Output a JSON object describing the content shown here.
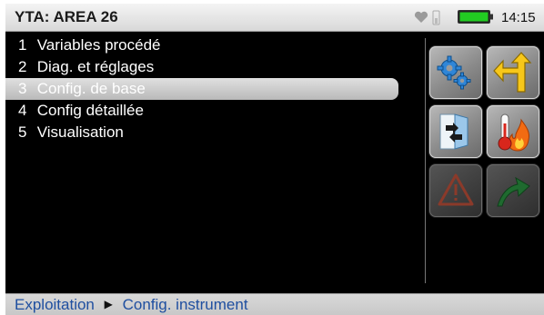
{
  "status_bar": {
    "title": "YTA: AREA 26",
    "time": "14:15",
    "icons": [
      "heart-icon",
      "signal-icon",
      "battery-icon"
    ],
    "battery_color": "#22cc22"
  },
  "menu": {
    "items": [
      {
        "num": "1",
        "label": "Variables procédé"
      },
      {
        "num": "2",
        "label": "Diag. et réglages"
      },
      {
        "num": "3",
        "label": "Config. de base",
        "selected": true
      },
      {
        "num": "4",
        "label": "Config détaillée"
      },
      {
        "num": "5",
        "label": "Visualisation"
      }
    ]
  },
  "tool_buttons": [
    {
      "name": "gears-icon",
      "enabled": true
    },
    {
      "name": "back-arrow-icon",
      "enabled": true
    },
    {
      "name": "door-transfer-icon",
      "enabled": true
    },
    {
      "name": "thermometer-fire-icon",
      "enabled": true
    },
    {
      "name": "warning-icon",
      "enabled": false
    },
    {
      "name": "trend-arrow-icon",
      "enabled": false
    }
  ],
  "breadcrumb": {
    "first": "Exploitation",
    "second": "Config. instrument"
  },
  "colors": {
    "accent_blue": "#1f4fa0",
    "screen_bg": "#000000"
  }
}
